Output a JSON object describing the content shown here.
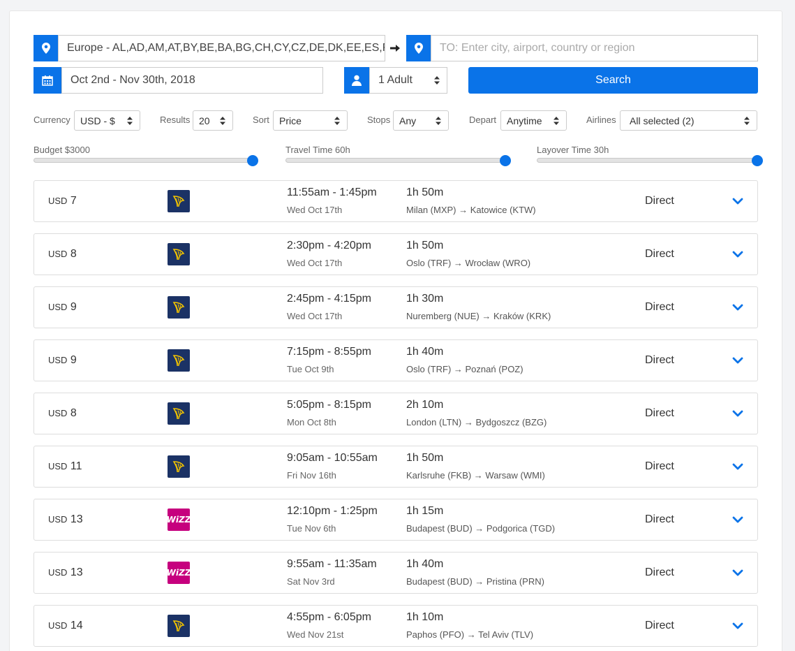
{
  "search": {
    "from_value": "Europe - AL,AD,AM,AT,BY,BE,BA,BG,CH,CY,CZ,DE,DK,EE,ES,FO",
    "to_placeholder": "TO: Enter city, airport, country or region",
    "dates_value": "Oct 2nd - Nov 30th, 2018",
    "passengers_value": "1 Adult",
    "search_label": "Search"
  },
  "filters": {
    "currency_label": "Currency",
    "currency_value": "USD - $",
    "results_label": "Results",
    "results_value": "20",
    "sort_label": "Sort",
    "sort_value": "Price",
    "stops_label": "Stops",
    "stops_value": "Any",
    "depart_label": "Depart",
    "depart_value": "Anytime",
    "airlines_label": "Airlines",
    "airlines_value": "All selected (2)"
  },
  "sliders": {
    "budget_label": "Budget $3000",
    "budget_fraction": 1.0,
    "travel_label": "Travel Time 60h",
    "travel_fraction": 1.0,
    "layover_label": "Layover Time 30h",
    "layover_fraction": 1.0
  },
  "colors": {
    "accent": "#0a73e8",
    "ryanair": "#1b3265",
    "wizz": "#c6007e",
    "harp": "#f2c300"
  },
  "flights": [
    {
      "currency": "USD",
      "price": "7",
      "airline": "ryanair",
      "times": "11:55am - 1:45pm",
      "date": "Wed Oct 17th",
      "duration": "1h 50m",
      "route": "Milan (MXP) → Katowice (KTW)",
      "stops": "Direct"
    },
    {
      "currency": "USD",
      "price": "8",
      "airline": "ryanair",
      "times": "2:30pm - 4:20pm",
      "date": "Wed Oct 17th",
      "duration": "1h 50m",
      "route": "Oslo (TRF) → Wrocław (WRO)",
      "stops": "Direct"
    },
    {
      "currency": "USD",
      "price": "9",
      "airline": "ryanair",
      "times": "2:45pm - 4:15pm",
      "date": "Wed Oct 17th",
      "duration": "1h 30m",
      "route": "Nuremberg (NUE) → Kraków (KRK)",
      "stops": "Direct"
    },
    {
      "currency": "USD",
      "price": "9",
      "airline": "ryanair",
      "times": "7:15pm - 8:55pm",
      "date": "Tue Oct 9th",
      "duration": "1h 40m",
      "route": "Oslo (TRF) → Poznań (POZ)",
      "stops": "Direct"
    },
    {
      "currency": "USD",
      "price": "8",
      "airline": "ryanair",
      "times": "5:05pm - 8:15pm",
      "date": "Mon Oct 8th",
      "duration": "2h 10m",
      "route": "London (LTN) → Bydgoszcz (BZG)",
      "stops": "Direct"
    },
    {
      "currency": "USD",
      "price": "11",
      "airline": "ryanair",
      "times": "9:05am - 10:55am",
      "date": "Fri Nov 16th",
      "duration": "1h 50m",
      "route": "Karlsruhe (FKB) → Warsaw (WMI)",
      "stops": "Direct"
    },
    {
      "currency": "USD",
      "price": "13",
      "airline": "wizz",
      "logo_text": "WiZZ",
      "times": "12:10pm - 1:25pm",
      "date": "Tue Nov 6th",
      "duration": "1h 15m",
      "route": "Budapest (BUD) → Podgorica (TGD)",
      "stops": "Direct"
    },
    {
      "currency": "USD",
      "price": "13",
      "airline": "wizz",
      "logo_text": "WiZZ",
      "times": "9:55am - 11:35am",
      "date": "Sat Nov 3rd",
      "duration": "1h 40m",
      "route": "Budapest (BUD) → Pristina (PRN)",
      "stops": "Direct"
    },
    {
      "currency": "USD",
      "price": "14",
      "airline": "ryanair",
      "times": "4:55pm - 6:05pm",
      "date": "Wed Nov 21st",
      "duration": "1h 10m",
      "route": "Paphos (PFO) → Tel Aviv (TLV)",
      "stops": "Direct"
    }
  ]
}
